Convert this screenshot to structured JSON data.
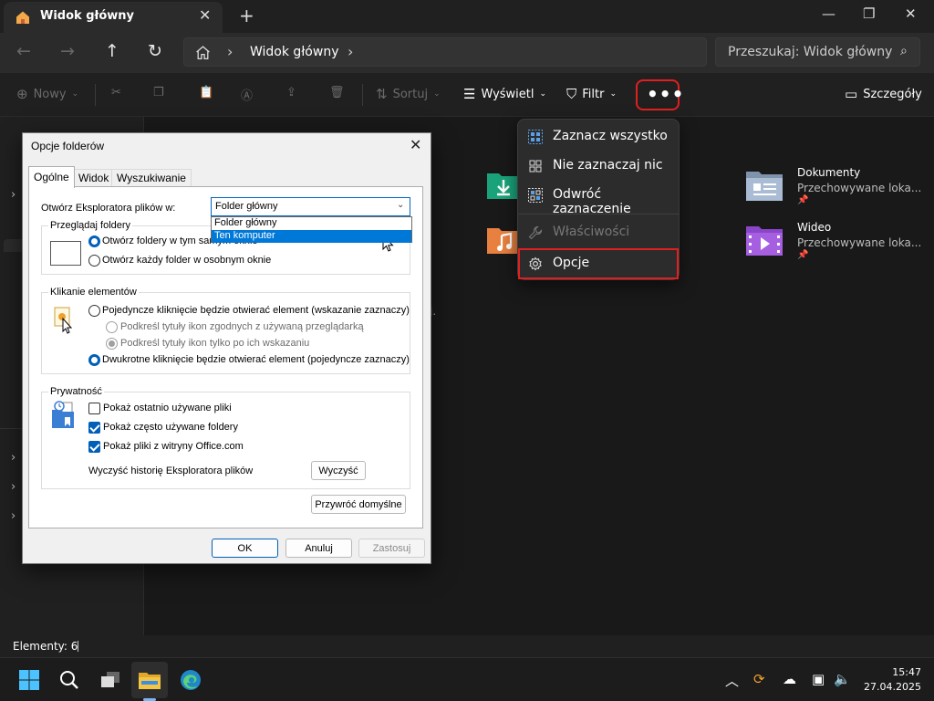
{
  "window": {
    "tab_title": "Widok główny",
    "address_crumb": "Widok główny",
    "search_placeholder": "Przeszukaj: Widok główny"
  },
  "commandbar": {
    "new_label": "Nowy",
    "sort_label": "Sortuj",
    "view_label": "Wyświetl",
    "filter_label": "Filtr",
    "more_label": "•••",
    "details_label": "Szczegóły"
  },
  "quick_access": [
    {
      "name": "Dokumenty",
      "sub": "Przechowywane loka..."
    },
    {
      "name": "Wideo",
      "sub": "Przechowywane loka..."
    }
  ],
  "content_fragment": "j.",
  "context_menu": {
    "items": [
      {
        "label": "Zaznacz wszystko",
        "icon": "select-all-icon",
        "enabled": true
      },
      {
        "label": "Nie zaznaczaj nic",
        "icon": "select-none-icon",
        "enabled": true
      },
      {
        "label": "Odwróć zaznaczenie",
        "icon": "invert-selection-icon",
        "enabled": true
      },
      {
        "label": "Właściwości",
        "icon": "wrench-icon",
        "enabled": false
      },
      {
        "label": "Opcje",
        "icon": "gear-icon",
        "enabled": true
      }
    ]
  },
  "dialog": {
    "title": "Opcje folderów",
    "tabs": [
      "Ogólne",
      "Widok",
      "Wyszukiwanie"
    ],
    "open_in_label": "Otwórz Eksploratora plików w:",
    "open_in_value": "Folder główny",
    "open_in_options": [
      "Folder główny",
      "Ten komputer"
    ],
    "browse_group": "Przeglądaj foldery",
    "browse_same": "Otwórz foldery w tym samym oknie",
    "browse_new": "Otwórz każdy folder w osobnym oknie",
    "click_group": "Klikanie elementów",
    "single_click": "Pojedyncze kliknięcie będzie otwierać element (wskazanie zaznaczy)",
    "underline_always": "Podkreśl tytuły ikon zgodnych z używaną przeglądarką",
    "underline_hover": "Podkreśl tytuły ikon tylko po ich wskazaniu",
    "double_click": "Dwukrotne kliknięcie będzie otwierać element (pojedyncze zaznaczy)",
    "privacy_group": "Prywatność",
    "show_recent": "Pokaż ostatnio używane pliki",
    "show_frequent": "Pokaż często używane foldery",
    "show_office": "Pokaż pliki z witryny Office.com",
    "clear_history_label": "Wyczyść historię Eksploratora plików",
    "clear_button": "Wyczyść",
    "restore_defaults": "Przywróć domyślne",
    "ok": "OK",
    "cancel": "Anuluj",
    "apply": "Zastosuj"
  },
  "status": {
    "items_count": "Elementy: 6"
  },
  "clock": {
    "time": "15:47",
    "date": "27.04.2025"
  },
  "colors": {
    "accent": "#005fb8",
    "highlight_red": "#e02020",
    "folder_yellow": "#f4c542"
  }
}
